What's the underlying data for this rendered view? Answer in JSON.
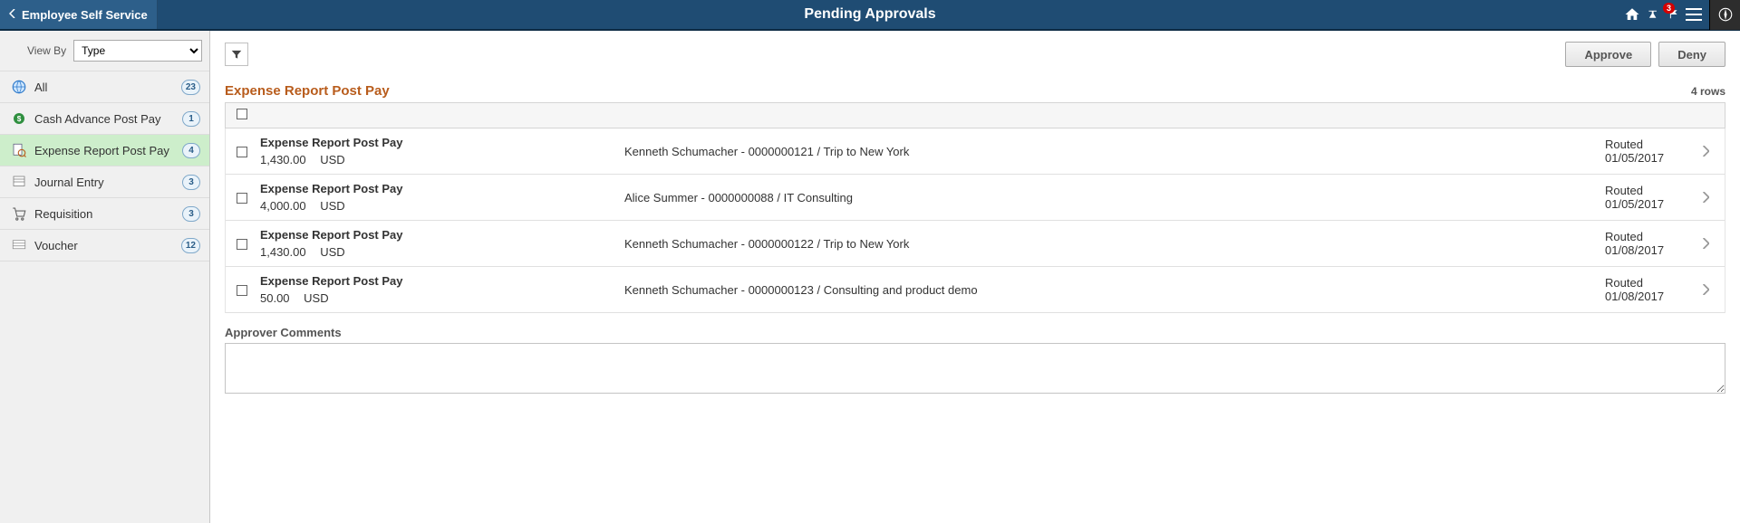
{
  "header": {
    "back_label": "Employee Self Service",
    "title": "Pending Approvals",
    "notification_count": "3"
  },
  "sidebar": {
    "viewby_label": "View By",
    "viewby_value": "Type",
    "items": [
      {
        "label": "All",
        "count": "23",
        "icon": "globe"
      },
      {
        "label": "Cash Advance Post Pay",
        "count": "1",
        "icon": "cash"
      },
      {
        "label": "Expense Report Post Pay",
        "count": "4",
        "icon": "report",
        "selected": true
      },
      {
        "label": "Journal Entry",
        "count": "3",
        "icon": "journal"
      },
      {
        "label": "Requisition",
        "count": "3",
        "icon": "cart"
      },
      {
        "label": "Voucher",
        "count": "12",
        "icon": "voucher"
      }
    ]
  },
  "toolbar": {
    "approve_label": "Approve",
    "deny_label": "Deny"
  },
  "section": {
    "title": "Expense Report Post Pay",
    "row_count_label": "4 rows",
    "comments_label": "Approver Comments"
  },
  "rows": [
    {
      "title": "Expense Report Post Pay",
      "amount": "1,430.00",
      "currency": "USD",
      "desc": "Kenneth Schumacher - 0000000121 / Trip to New York",
      "status": "Routed",
      "date": "01/05/2017"
    },
    {
      "title": "Expense Report Post Pay",
      "amount": "4,000.00",
      "currency": "USD",
      "desc": "Alice Summer - 0000000088 / IT Consulting",
      "status": "Routed",
      "date": "01/05/2017"
    },
    {
      "title": "Expense Report Post Pay",
      "amount": "1,430.00",
      "currency": "USD",
      "desc": "Kenneth Schumacher - 0000000122 / Trip to New York",
      "status": "Routed",
      "date": "01/08/2017"
    },
    {
      "title": "Expense Report Post Pay",
      "amount": "50.00",
      "currency": "USD",
      "desc": "Kenneth Schumacher - 0000000123 / Consulting and product demo",
      "status": "Routed",
      "date": "01/08/2017"
    }
  ]
}
